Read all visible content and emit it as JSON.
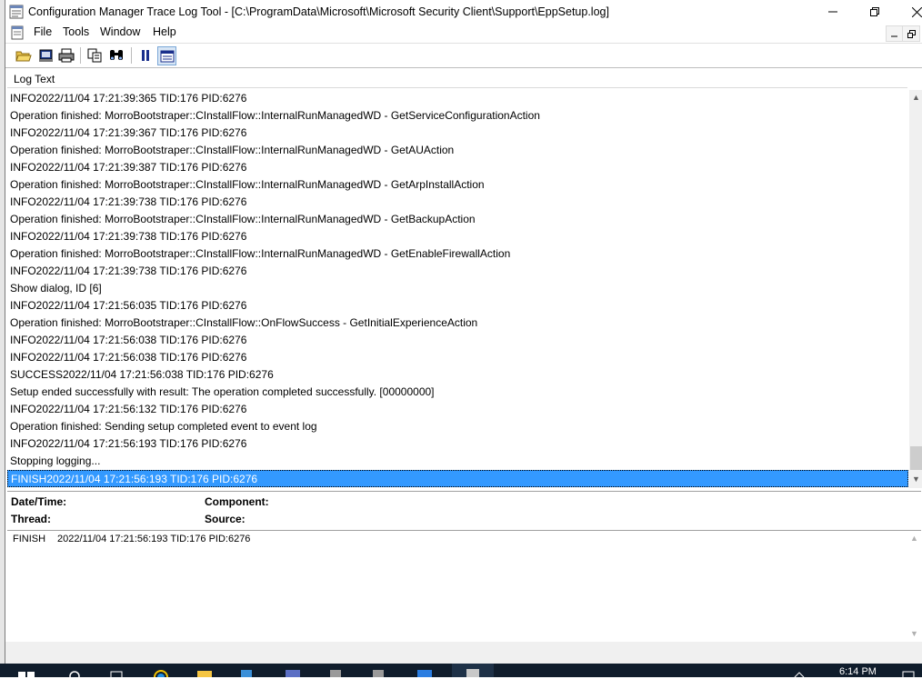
{
  "window": {
    "title": "Configuration Manager Trace Log Tool - [C:\\ProgramData\\Microsoft\\Microsoft Security Client\\Support\\EppSetup.log]"
  },
  "menu": {
    "items": [
      {
        "label": "File"
      },
      {
        "label": "Tools"
      },
      {
        "label": "Window"
      },
      {
        "label": "Help"
      }
    ]
  },
  "toolbar": {
    "icons": [
      "open-icon",
      "print-preview-icon",
      "print-icon",
      "copy-icon",
      "find-icon",
      "pause-icon",
      "show-details-icon"
    ]
  },
  "log": {
    "column_header": "Log Text",
    "rows": [
      "INFO2022/11/04 17:21:39:365 TID:176 PID:6276",
      "Operation finished: MorroBootstraper::CInstallFlow::InternalRunManagedWD - GetServiceConfigurationAction",
      "INFO2022/11/04 17:21:39:367 TID:176 PID:6276",
      "Operation finished: MorroBootstraper::CInstallFlow::InternalRunManagedWD - GetAUAction",
      "INFO2022/11/04 17:21:39:387 TID:176 PID:6276",
      "Operation finished: MorroBootstraper::CInstallFlow::InternalRunManagedWD - GetArpInstallAction",
      "INFO2022/11/04 17:21:39:738 TID:176 PID:6276",
      "Operation finished: MorroBootstraper::CInstallFlow::InternalRunManagedWD - GetBackupAction",
      "INFO2022/11/04 17:21:39:738 TID:176 PID:6276",
      "Operation finished: MorroBootstraper::CInstallFlow::InternalRunManagedWD - GetEnableFirewallAction",
      "INFO2022/11/04 17:21:39:738 TID:176 PID:6276",
      "Show dialog, ID [6]",
      "INFO2022/11/04 17:21:56:035 TID:176 PID:6276",
      "Operation finished: MorroBootstraper::CInstallFlow::OnFlowSuccess - GetInitialExperienceAction",
      "INFO2022/11/04 17:21:56:038 TID:176 PID:6276",
      "INFO2022/11/04 17:21:56:038 TID:176 PID:6276",
      "SUCCESS2022/11/04 17:21:56:038 TID:176 PID:6276",
      "Setup ended successfully with result: The operation completed successfully.   [00000000]",
      "INFO2022/11/04 17:21:56:132 TID:176 PID:6276",
      "Operation finished: Sending setup completed event to event log",
      "INFO2022/11/04 17:21:56:193 TID:176 PID:6276",
      "Stopping logging...",
      "FINISH2022/11/04 17:21:56:193 TID:176 PID:6276"
    ],
    "selected_index": 22
  },
  "details": {
    "datetime_label": "Date/Time:",
    "component_label": "Component:",
    "thread_label": "Thread:",
    "source_label": "Source:",
    "text_type": "FINISH",
    "text_value": "2022/11/04 17:21:56:193 TID:176 PID:6276"
  },
  "taskbar": {
    "clock": "6:14 PM"
  },
  "colors": {
    "selection": "#3399ff",
    "taskbar": "#101d2c"
  }
}
